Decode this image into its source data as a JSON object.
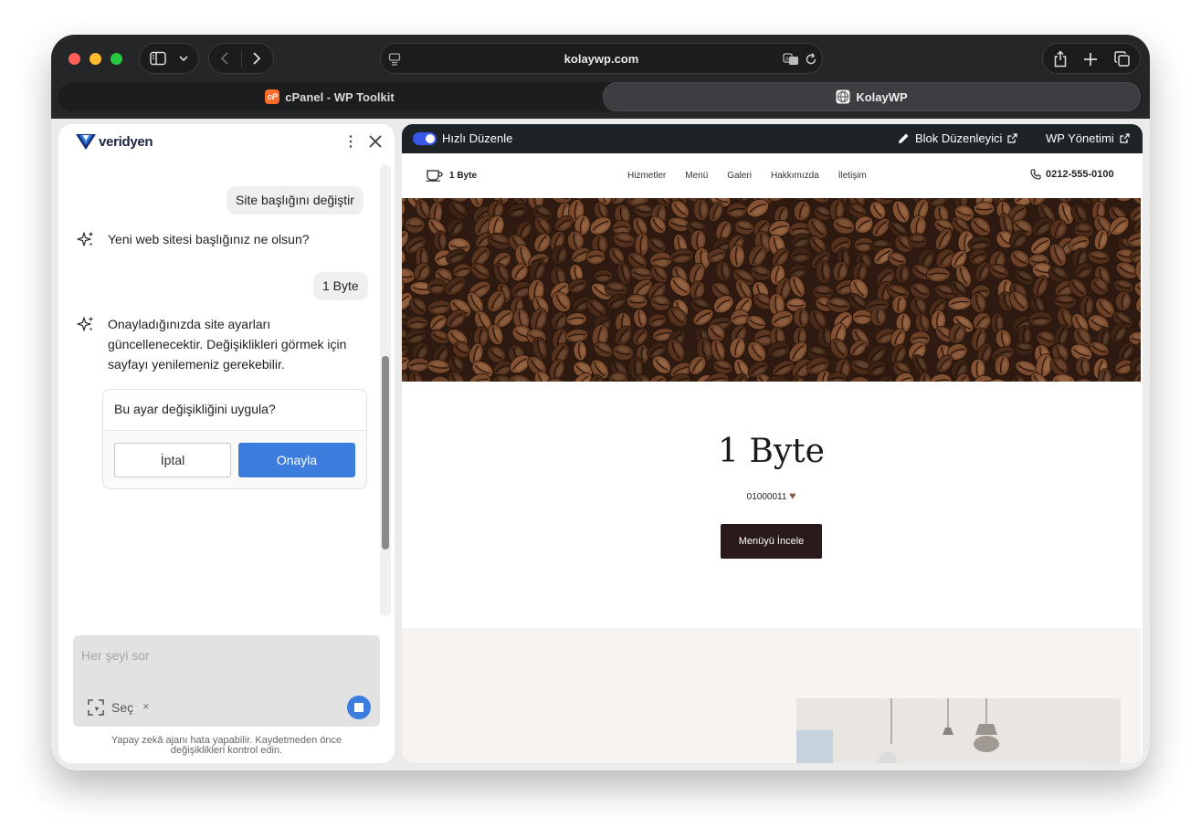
{
  "browser": {
    "url": "kolaywp.com",
    "tabs": [
      {
        "label": "cPanel - WP Toolkit",
        "icon": "cpanel-icon",
        "active": false
      },
      {
        "label": "KolayWP",
        "icon": "globe-icon",
        "active": true
      }
    ]
  },
  "chat": {
    "brand": "veridyen",
    "messages": {
      "user_1": "Site başlığını değiştir",
      "ai_1": "Yeni web sitesi başlığınız ne olsun?",
      "user_2": "1 Byte",
      "ai_2": "Onayladığınızda site ayarları güncellenecektir. Değişiklikleri görmek için sayfayı yenilemeniz gerekebilir."
    },
    "confirm": {
      "question": "Bu ayar değişikliğini uygula?",
      "cancel": "İptal",
      "ok": "Onayla"
    },
    "input": {
      "placeholder": "Her şeyi sor",
      "select_label": "Seç",
      "clear": "×"
    },
    "disclaimer": "Yapay zekâ ajanı hata yapabilir. Kaydetmeden önce değişiklikleri kontrol edin."
  },
  "editbar": {
    "quick_edit": "Hızlı Düzenle",
    "block_editor": "Blok Düzenleyici",
    "wp_manage": "WP Yönetimi"
  },
  "site": {
    "logo_text": "1 Byte",
    "menu": [
      "Hizmetler",
      "Menü",
      "Galeri",
      "Hakkımızda",
      "İletişim"
    ],
    "phone": "0212-555-0100",
    "title": "1 Byte",
    "tagline": "01000011",
    "tagline_icon": "♥",
    "cta": "Menüyü İncele"
  },
  "colors": {
    "accent": "#3b7ddd",
    "editbar": "#1d2327",
    "cta": "#2a1a1a"
  }
}
